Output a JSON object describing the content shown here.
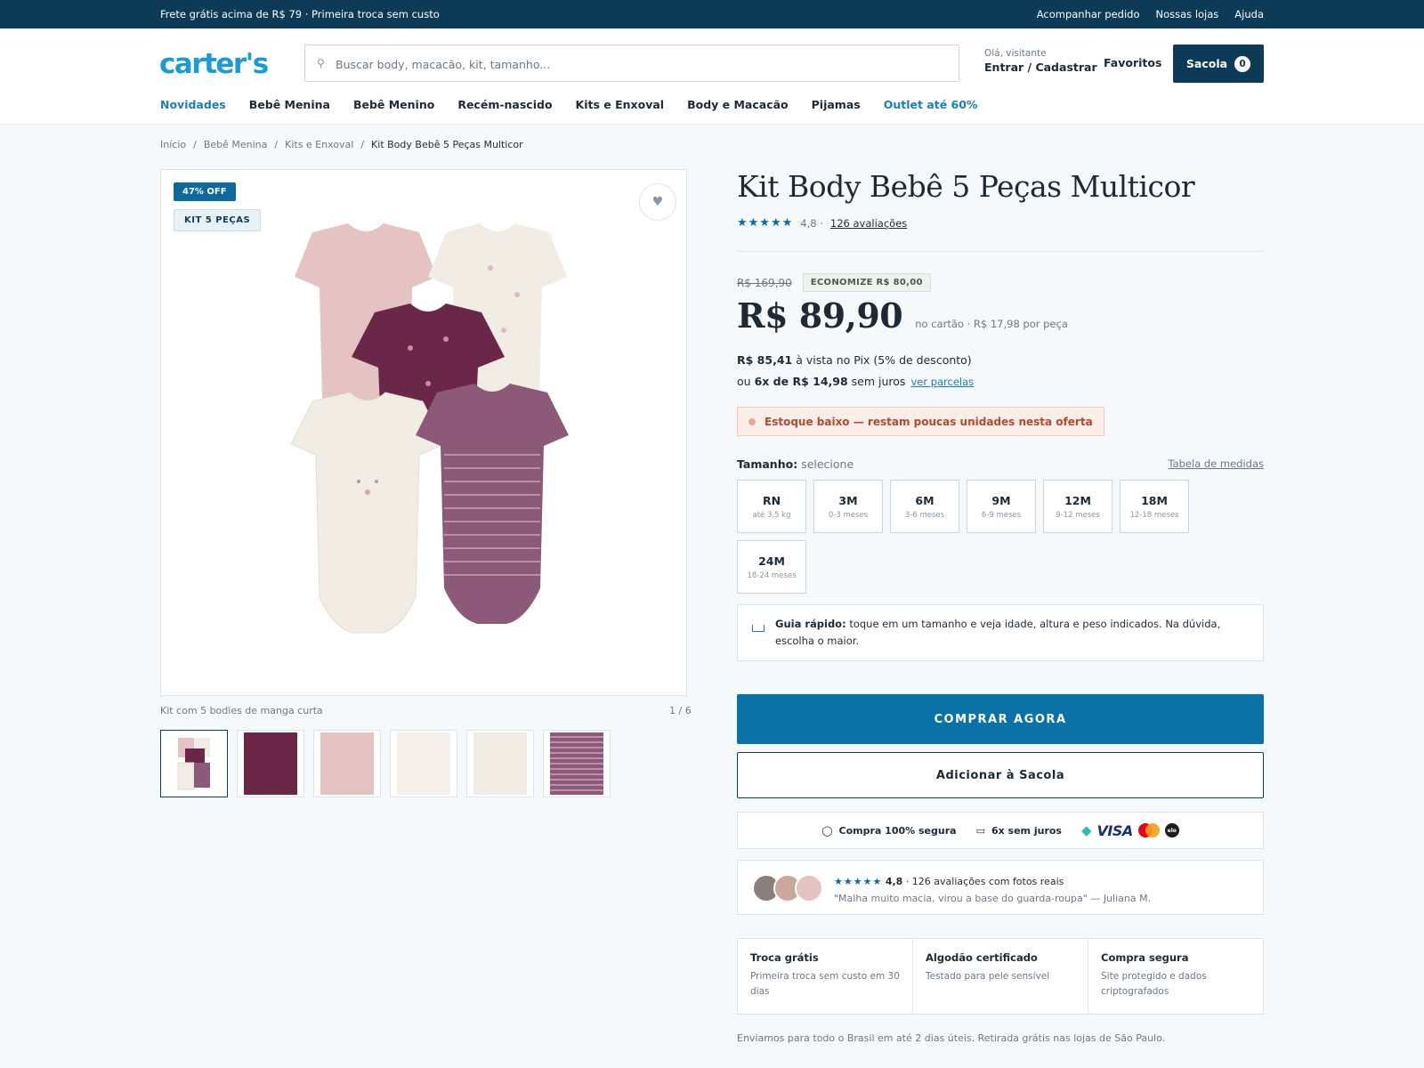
{
  "topbar": {
    "promo": "Frete grátis acima de R$ 79 · Primeira troca sem custo",
    "links": [
      "Acompanhar pedido",
      "Nossas lojas",
      "Ajuda"
    ]
  },
  "header": {
    "logo": "carter's",
    "search_placeholder": "Buscar body, macacão, kit, tamanho...",
    "search_icon": "search-icon",
    "greeting": "Olá, visitante",
    "login": "Entrar / Cadastrar",
    "favorites": "Favoritos",
    "bag_label": "Sacola",
    "bag_count": "0"
  },
  "nav": [
    "Novidades",
    "Bebê Menina",
    "Bebê Menino",
    "Recém-nascido",
    "Kits e Enxoval",
    "Body e Macacão",
    "Pijamas",
    "Outlet até 60%"
  ],
  "breadcrumb": {
    "items": [
      "Início",
      "Bebê Menina",
      "Kits e Enxoval"
    ],
    "current": "Kit Body Bebê 5 Peças Multicor",
    "separator": "/"
  },
  "gallery": {
    "badge_off": "47% OFF",
    "badge_kit": "KIT 5 PEÇAS",
    "wish_icon": "heart-icon",
    "caption": "Kit com 5 bodies de manga curta",
    "counter": "1 / 6",
    "colors": {
      "pink": "#e6c3c3",
      "cream": "#f2ede4",
      "plum": "#6b2748",
      "mauve": "#8c5a78"
    }
  },
  "product": {
    "title": "Kit Body Bebê 5 Peças Multicor",
    "stars": "★★★★★",
    "rating": "4,8 ·",
    "reviews_link": "126 avaliações",
    "old_price": "R$ 169,90",
    "savings": "ECONOMIZE R$ 80,00",
    "price": "R$ 89,90",
    "price_note": "no cartão · R$ 17,98 por peça",
    "pix_value": "R$ 85,41",
    "pix_text": "à vista no Pix (5% de desconto)",
    "installments_prefix": "ou",
    "installments_value": "6x de R$ 14,98",
    "installments_suffix": "sem juros",
    "installments_link": "ver parcelas",
    "stock": "Estoque baixo — restam poucas unidades nesta oferta",
    "size_label": "Tamanho:",
    "size_hint": "selecione",
    "size_table": "Tabela de medidas",
    "sizes": [
      {
        "name": "RN",
        "desc": "até 3,5 kg"
      },
      {
        "name": "3M",
        "desc": "0-3 meses"
      },
      {
        "name": "6M",
        "desc": "3-6 meses"
      },
      {
        "name": "9M",
        "desc": "6-9 meses"
      },
      {
        "name": "12M",
        "desc": "9-12 meses"
      },
      {
        "name": "18M",
        "desc": "12-18 meses"
      },
      {
        "name": "24M",
        "desc": "18-24 meses"
      }
    ],
    "guide_title": "Guia rápido:",
    "guide_text": "toque em um tamanho e veja idade, altura e peso indicados. Na dúvida, escolha o maior.",
    "buy": "COMPRAR AGORA",
    "add": "Adicionar à Sacola"
  },
  "trust": {
    "secure": "Compra 100% segura",
    "installments": "6x sem juros",
    "visa": "VISA",
    "elo": "elo",
    "card_colors": {
      "mc_red": "#eb001b",
      "mc_yellow": "#f79e1b",
      "pix": "#32bcad"
    }
  },
  "reviews": {
    "stars": "★★★★★",
    "score": "4,8",
    "summary": "· 126 avaliações com fotos reais",
    "quote": "\"Malha muito macia, virou a base do guarda-roupa\" — Juliana M."
  },
  "features": [
    {
      "title": "Troca grátis",
      "text": "Primeira troca sem custo em 30 dias"
    },
    {
      "title": "Algodão certificado",
      "text": "Testado para pele sensível"
    },
    {
      "title": "Compra segura",
      "text": "Site protegido e dados criptografados"
    }
  ],
  "shipping": "Enviamos para todo o Brasil em até 2 dias úteis. Retirada grátis nas lojas de São Paulo."
}
